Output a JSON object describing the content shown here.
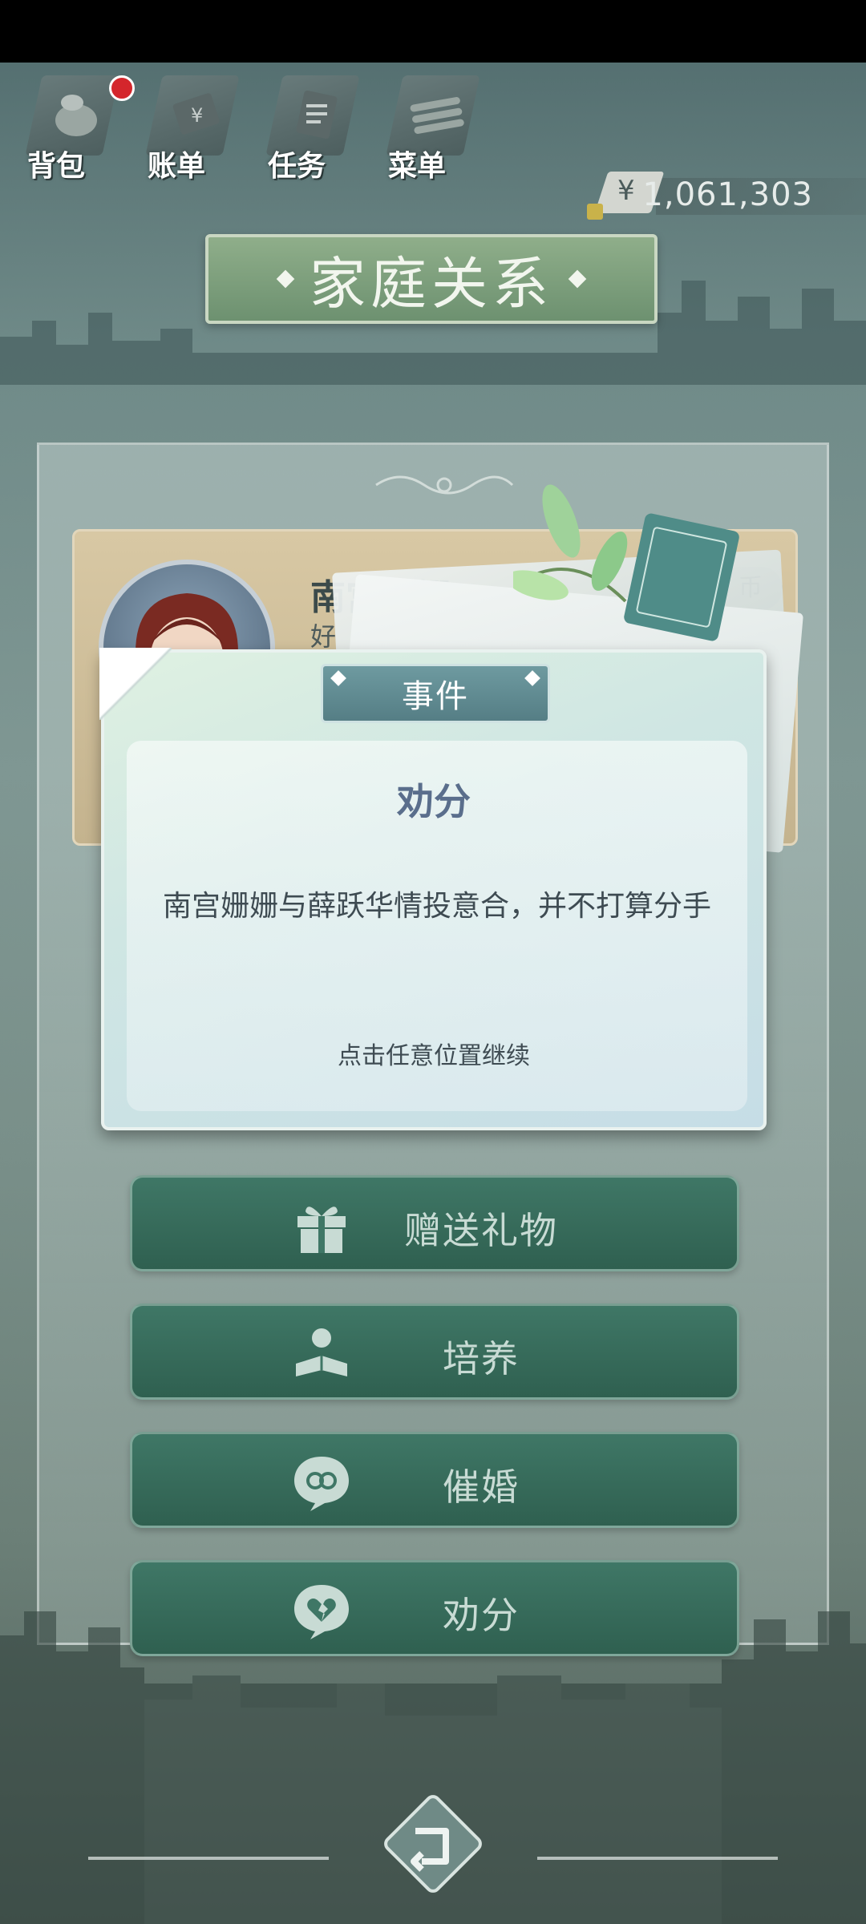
{
  "topnav": {
    "items": [
      {
        "label": "背包",
        "icon": "backpack-icon"
      },
      {
        "label": "账单",
        "icon": "bill-icon"
      },
      {
        "label": "任务",
        "icon": "task-icon"
      },
      {
        "label": "菜单",
        "icon": "menu-icon"
      }
    ],
    "money": {
      "currency_symbol": "¥",
      "amount": "1,061,303"
    }
  },
  "page": {
    "title": "家庭关系"
  },
  "character": {
    "name": "南宫姗姗",
    "sub_label": "好",
    "tag": "币"
  },
  "event_dialog": {
    "tab_label": "事件",
    "title": "劝分",
    "body": "南宫姗姗与薛跃华情投意合，并不打算分手",
    "hint": "点击任意位置继续"
  },
  "actions": [
    {
      "label": "赠送礼物",
      "icon": "gift-icon"
    },
    {
      "label": "培养",
      "icon": "reading-person-icon"
    },
    {
      "label": "催婚",
      "icon": "gender-bubble-icon"
    },
    {
      "label": "劝分",
      "icon": "broken-heart-icon"
    }
  ],
  "colors": {
    "accent_green": "#3f7766",
    "title_green": "#8fae8a",
    "dialog_title": "#5a6e8c",
    "badge_red": "#d4262c"
  }
}
